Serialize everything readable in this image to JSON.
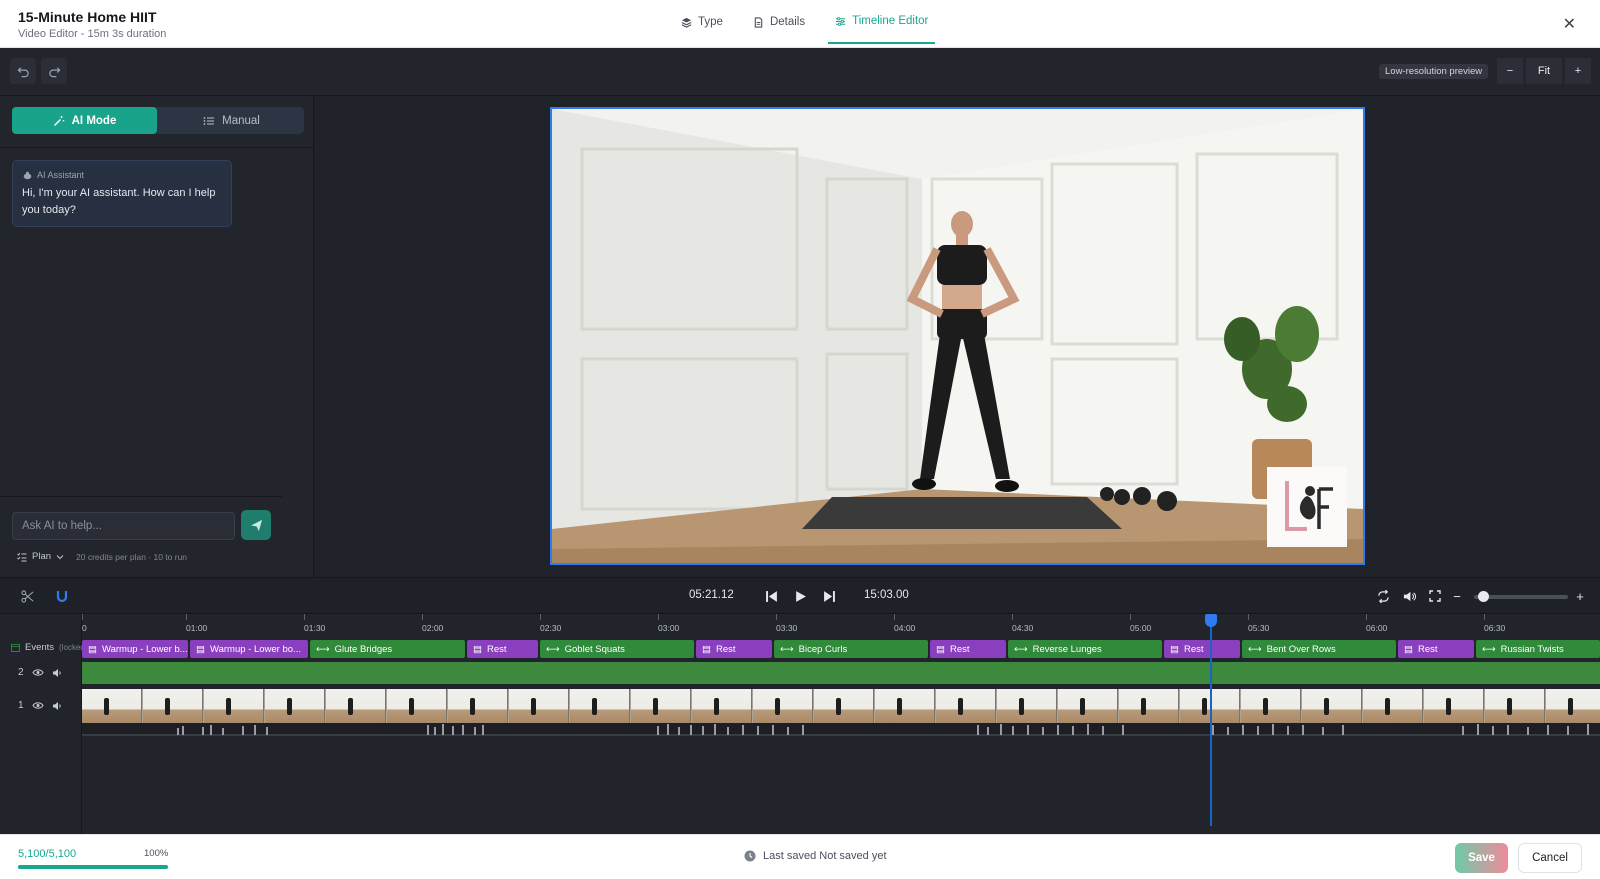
{
  "header": {
    "title": "15-Minute Home HIIT",
    "subtitle": "Video Editor - 15m 3s duration",
    "tabs": [
      {
        "label": "Type",
        "icon": "layers-icon",
        "active": false
      },
      {
        "label": "Details",
        "icon": "document-icon",
        "active": false
      },
      {
        "label": "Timeline Editor",
        "icon": "sliders-icon",
        "active": true
      }
    ],
    "close_icon": "close-icon"
  },
  "toolbar": {
    "undo_icon": "undo-icon",
    "redo_icon": "redo-icon",
    "preview_badge": "Low-resolution preview",
    "zoom_out": "−",
    "zoom_fit": "Fit",
    "zoom_in": "+"
  },
  "left_panel": {
    "modes": [
      {
        "label": "AI Mode",
        "icon": "magic-wand-icon",
        "active": true
      },
      {
        "label": "Manual",
        "icon": "list-icon",
        "active": false
      }
    ],
    "assistant": {
      "sender": "AI Assistant",
      "message": "Hi, I'm your AI assistant. How can I help you today?"
    },
    "input_placeholder": "Ask AI to help...",
    "plan_label": "Plan",
    "credits_note": "20 credits per plan · 10 to run"
  },
  "transport": {
    "current_time": "05:21.12",
    "total_time": "15:03.00"
  },
  "timeline": {
    "ruler_ticks": [
      "0",
      "01:00",
      "01:30",
      "02:00",
      "02:30",
      "03:00",
      "03:30",
      "04:00",
      "04:30",
      "05:00",
      "05:30",
      "06:00",
      "06:30"
    ],
    "events_label": "Events",
    "events_locked": "(locked)",
    "events": [
      {
        "label": "Warmup - Lower b...",
        "kind": "rest"
      },
      {
        "label": "Warmup - Lower bo...",
        "kind": "rest"
      },
      {
        "label": "Glute Bridges",
        "kind": "ex"
      },
      {
        "label": "Rest",
        "kind": "rest"
      },
      {
        "label": "Goblet Squats",
        "kind": "ex"
      },
      {
        "label": "Rest",
        "kind": "rest"
      },
      {
        "label": "Bicep Curls",
        "kind": "ex"
      },
      {
        "label": "Rest",
        "kind": "rest"
      },
      {
        "label": "Reverse Lunges",
        "kind": "ex"
      },
      {
        "label": "Rest",
        "kind": "rest"
      },
      {
        "label": "Bent Over Rows",
        "kind": "ex"
      },
      {
        "label": "Rest",
        "kind": "rest"
      },
      {
        "label": "Russian Twists",
        "kind": "ex"
      }
    ],
    "tracks": [
      {
        "number": "2"
      },
      {
        "number": "1"
      }
    ]
  },
  "footer": {
    "credits_used": "5,100/5,100",
    "credits_percent": "100%",
    "credits_progress": 1.0,
    "last_saved": "Last saved Not saved yet",
    "save_label": "Save",
    "cancel_label": "Cancel"
  },
  "colors": {
    "accent": "#17a88f",
    "rest_segment": "#8a3fbf",
    "exercise_segment": "#2f8a3a",
    "playhead": "#2f7cf0"
  }
}
